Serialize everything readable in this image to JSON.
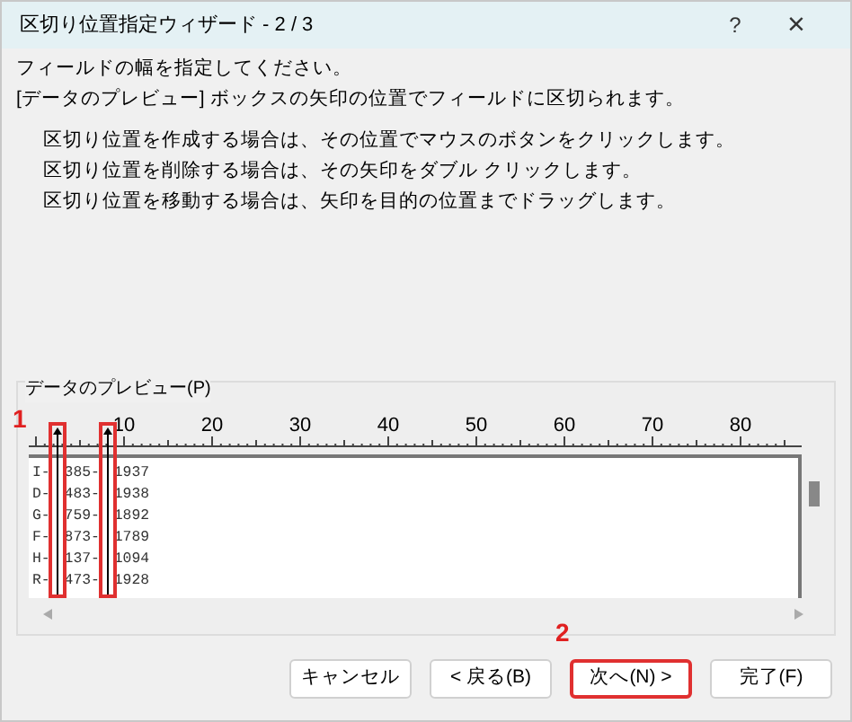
{
  "window": {
    "title": "区切り位置指定ウィザード - 2 / 3",
    "help": "?",
    "close": "×"
  },
  "intro": [
    "フィールドの幅を指定してください。",
    "[データのプレビュー] ボックスの矢印の位置でフィールドに区切られます。"
  ],
  "instructions": [
    "区切り位置を作成する場合は、その位置でマウスのボタンをクリックします。",
    "区切り位置を削除する場合は、その矢印をダブル クリックします。",
    "区切り位置を移動する場合は、矢印を目的の位置までドラッグします。"
  ],
  "preview": {
    "label": "データのプレビュー(P)",
    "step_label": "1",
    "ruler": [
      "10",
      "20",
      "30",
      "40",
      "50",
      "60",
      "70",
      "80"
    ],
    "rows": [
      [
        "I-",
        "385-",
        "1937"
      ],
      [
        "D-",
        "483-",
        "1938"
      ],
      [
        "G-",
        "759-",
        "1892"
      ],
      [
        "F-",
        "873-",
        "1789"
      ],
      [
        "H-",
        "137-",
        "1094"
      ],
      [
        "R-",
        "473-",
        "1928"
      ]
    ],
    "breaks": [
      {
        "highlighted": true
      },
      {
        "highlighted": true
      }
    ]
  },
  "buttons": [
    {
      "label": "キャンセル",
      "highlighted": false
    },
    {
      "label": "< 戻る(B)",
      "highlighted": false
    },
    {
      "label": "次へ(N) >",
      "highlighted": true,
      "step_label": "2"
    },
    {
      "label": "完了(F)",
      "highlighted": false
    }
  ]
}
